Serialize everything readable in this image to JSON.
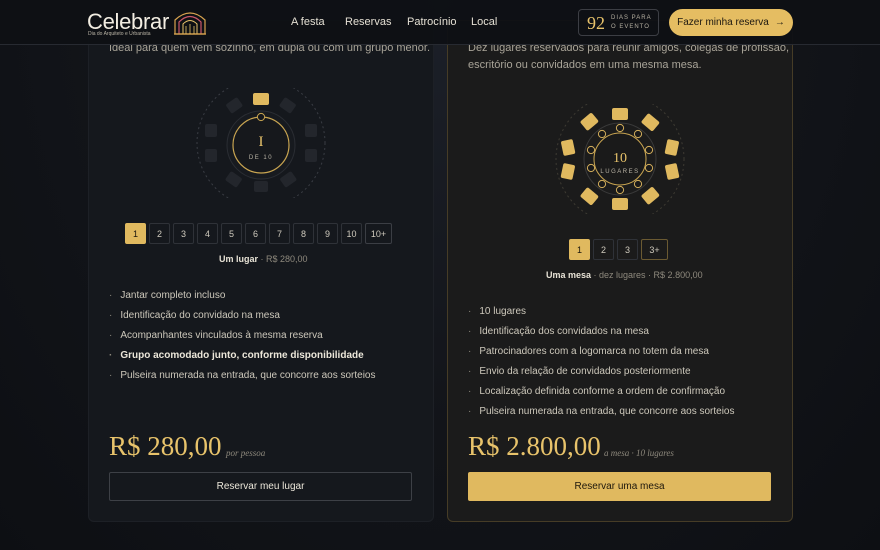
{
  "header": {
    "logo_word": "Celebrar",
    "logo_sub": "Dia do Arquiteto e Urbanista",
    "nav": [
      "A festa",
      "Reservas",
      "Patrocínio",
      "Local"
    ],
    "countdown": {
      "number": "92",
      "label_line1": "DIAS PARA",
      "label_line2": "O EVENTO"
    },
    "cta": "Fazer minha reserva",
    "cta_arrow": "→"
  },
  "left_card": {
    "description": "Ideal para quem vem sozinho, em dupla ou com um grupo menor.",
    "table": {
      "numeral": "I",
      "sub": "DE 10"
    },
    "pager": [
      "1",
      "2",
      "3",
      "4",
      "5",
      "6",
      "7",
      "8",
      "9",
      "10",
      "10+"
    ],
    "selected_index": 0,
    "caption_bold": "Um lugar",
    "caption_rest": " · R$ 280,00",
    "features": [
      "Jantar completo incluso",
      "Identificação do convidado na mesa",
      "Acompanhantes vinculados à mesma reserva",
      "Grupo acomodado junto, conforme disponibilidade",
      "Pulseira numerada na entrada, que concorre aos sorteios"
    ],
    "price": "R$ 280,00",
    "price_note": "por pessoa",
    "button": "Reservar meu lugar"
  },
  "right_card": {
    "description_line1": "Dez lugares reservados para reunir amigos, colegas de profissão,",
    "description_line2": "escritório ou convidados em uma mesma mesa.",
    "table": {
      "numeral": "10",
      "sub": "LUGARES"
    },
    "pager": [
      "1",
      "2",
      "3",
      "3+"
    ],
    "selected_index": 0,
    "caption_bold": "Uma mesa",
    "caption_rest": " · dez lugares · R$ 2.800,00",
    "features": [
      "10 lugares",
      "Identificação dos convidados na mesa",
      "Patrocinadores com a logomarca no totem da mesa",
      "Envio da relação de convidados posteriormente",
      "Localização definida conforme a ordem de confirmação",
      "Pulseira numerada na entrada, que concorre aos sorteios"
    ],
    "price": "R$ 2.800,00",
    "price_note": "a mesa · 10 lugares",
    "button": "Reservar uma mesa"
  },
  "colors": {
    "gold": "#e0b95f",
    "background": "#121419"
  }
}
